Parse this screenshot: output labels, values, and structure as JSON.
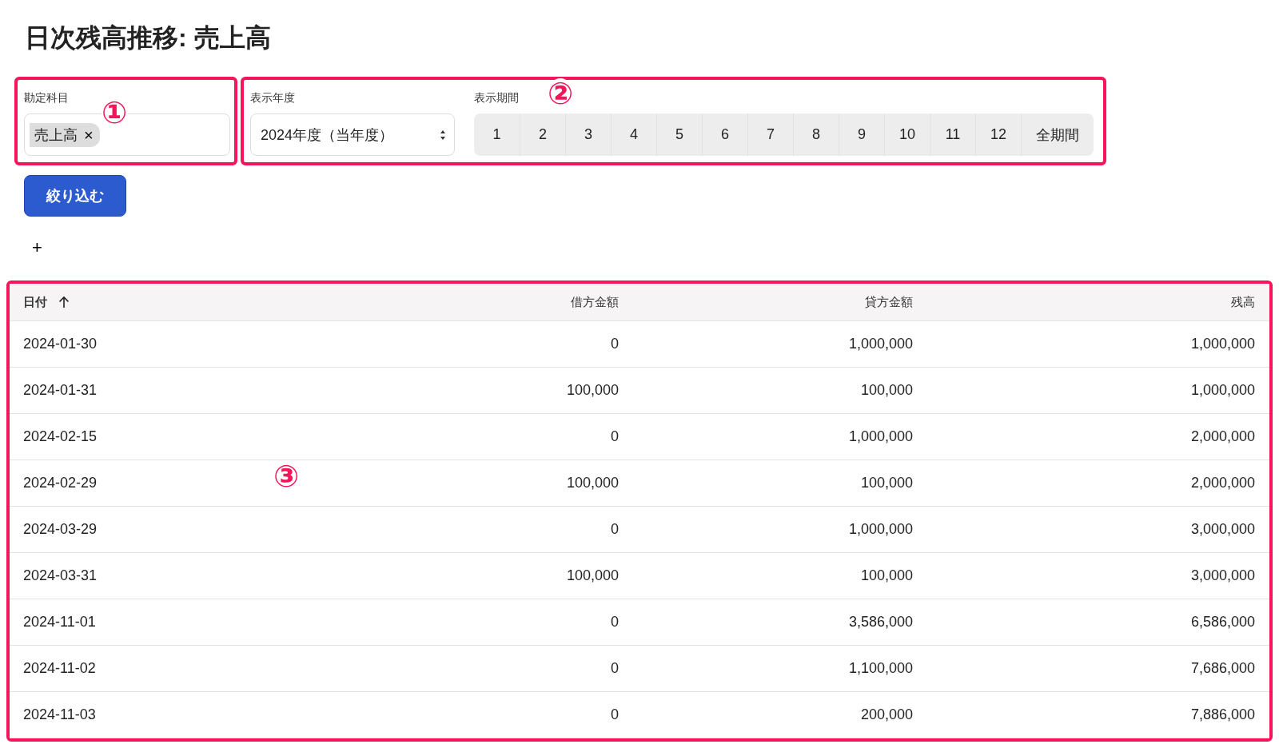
{
  "title": "日次残高推移: 売上高",
  "account_filter": {
    "label": "勘定科目",
    "tags": [
      {
        "label": "売上高",
        "remove": "×"
      }
    ]
  },
  "year_filter": {
    "label": "表示年度",
    "value": "2024年度（当年度）"
  },
  "period_filter": {
    "label": "表示期間",
    "options": [
      {
        "label": "1",
        "selected": false
      },
      {
        "label": "2",
        "selected": false
      },
      {
        "label": "3",
        "selected": false
      },
      {
        "label": "4",
        "selected": false
      },
      {
        "label": "5",
        "selected": false
      },
      {
        "label": "6",
        "selected": false
      },
      {
        "label": "7",
        "selected": false
      },
      {
        "label": "8",
        "selected": false
      },
      {
        "label": "9",
        "selected": false
      },
      {
        "label": "10",
        "selected": false
      },
      {
        "label": "11",
        "selected": false
      },
      {
        "label": "12",
        "selected": false
      },
      {
        "label": "全期間",
        "selected": false
      }
    ]
  },
  "filter_button": "絞り込む",
  "add_button": "+",
  "table": {
    "columns": [
      {
        "label": "日付",
        "sorted": true
      },
      {
        "label": "借方金額",
        "sorted": false
      },
      {
        "label": "貸方金額",
        "sorted": false
      },
      {
        "label": "残高",
        "sorted": false
      }
    ],
    "rows": [
      [
        "2024-01-30",
        "0",
        "1,000,000",
        "1,000,000"
      ],
      [
        "2024-01-31",
        "100,000",
        "100,000",
        "1,000,000"
      ],
      [
        "2024-02-15",
        "0",
        "1,000,000",
        "2,000,000"
      ],
      [
        "2024-02-29",
        "100,000",
        "100,000",
        "2,000,000"
      ],
      [
        "2024-03-29",
        "0",
        "1,000,000",
        "3,000,000"
      ],
      [
        "2024-03-31",
        "100,000",
        "100,000",
        "3,000,000"
      ],
      [
        "2024-11-01",
        "0",
        "3,586,000",
        "6,586,000"
      ],
      [
        "2024-11-02",
        "0",
        "1,100,000",
        "7,686,000"
      ],
      [
        "2024-11-03",
        "0",
        "200,000",
        "7,886,000"
      ]
    ]
  },
  "annotations": [
    "①",
    "②",
    "③"
  ]
}
